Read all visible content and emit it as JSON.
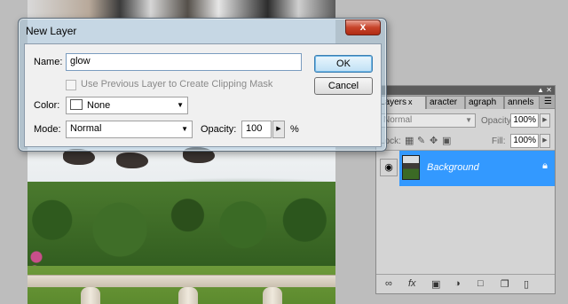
{
  "dialog": {
    "title": "New Layer",
    "close_glyph": "x",
    "name_label": "Name:",
    "name_value": "glow",
    "clipping_label": "Use Previous Layer to Create Clipping Mask",
    "clipping_checked": false,
    "color_label": "Color:",
    "color_value": "None",
    "mode_label": "Mode:",
    "mode_value": "Normal",
    "opacity_label": "Opacity:",
    "opacity_value": "100",
    "opacity_unit": "%",
    "ok_label": "OK",
    "cancel_label": "Cancel"
  },
  "layers_panel": {
    "tabs": [
      {
        "label": "Layers",
        "close": "x",
        "active": true
      },
      {
        "label": "aracter",
        "active": false
      },
      {
        "label": "agraph",
        "active": false
      },
      {
        "label": "annels",
        "active": false
      }
    ],
    "blend_mode": "Normal",
    "opacity_label": "Opacity:",
    "opacity_value": "100%",
    "lock_label": "Lock:",
    "fill_label": "Fill:",
    "fill_value": "100%",
    "layers": [
      {
        "name": "Background",
        "visible": true,
        "locked": true,
        "selected": true
      }
    ],
    "selection_color": "#3399ff"
  },
  "icons": {
    "eye": "eye-icon",
    "lock": "lock-icon",
    "link": "link-layers-icon",
    "fx": "fx-icon",
    "mask": "add-mask-icon",
    "adjustment": "adjustment-layer-icon",
    "group": "folder-icon",
    "new_layer": "new-layer-icon",
    "trash": "trash-icon"
  }
}
